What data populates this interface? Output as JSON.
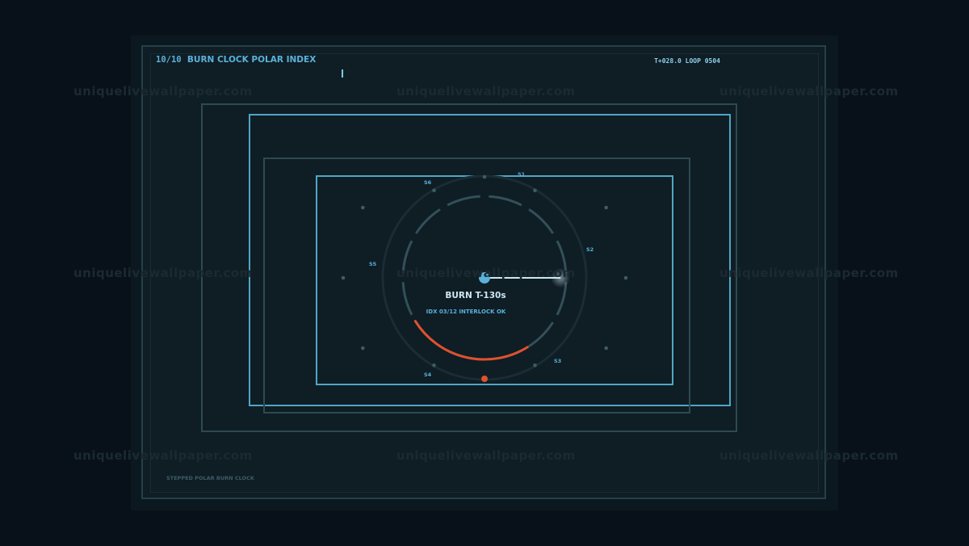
{
  "header": {
    "index": "10/10",
    "title": "BURN CLOCK POLAR INDEX",
    "timer": "T+028.0  LOOP 0504"
  },
  "dial": {
    "burn_label": "BURN T-130s",
    "status": "IDX 03/12  INTERLOCK OK",
    "segments": [
      "S1",
      "S2",
      "S3",
      "S4",
      "S5",
      "S6"
    ],
    "burn_progress": 0.25
  },
  "footer": {
    "caption": "STEPPED POLAR BURN CLOCK"
  },
  "watermark": "uniquelivewallpaper.com",
  "colors": {
    "background": "#08111a",
    "panel": "#0f1d25",
    "accent": "#5ab2da",
    "frame_dim": "#2d4a53",
    "burn": "#e0512e",
    "hand": "#cde7f2"
  }
}
